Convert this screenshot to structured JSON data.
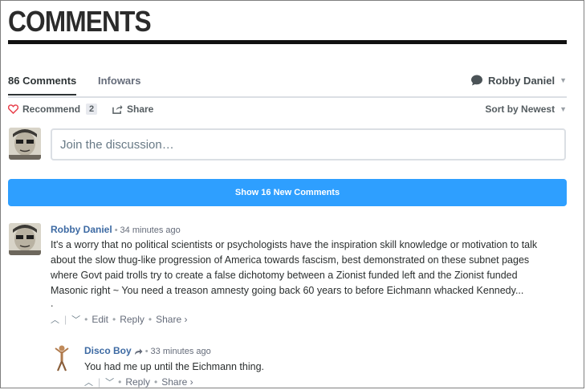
{
  "page_title": "COMMENTS",
  "nav": {
    "comment_count_tab": "86 Comments",
    "community_tab": "Infowars",
    "user_name": "Robby Daniel"
  },
  "actions": {
    "recommend_label": "Recommend",
    "recommend_count": "2",
    "share_label": "Share",
    "sort_label": "Sort by Newest"
  },
  "composer": {
    "placeholder": "Join the discussion…"
  },
  "new_comments_button": "Show 16 New Comments",
  "comments": [
    {
      "author": "Robby Daniel",
      "time": "34 minutes ago",
      "body_lines": [
        "It's a worry that no political scientists or psychologists have the inspiration skill knowledge or motivation to talk",
        "about the slow thug-like progression of America towards fascism, best demonstrated on these subnet pages",
        "where Govt paid trolls try to create a false dichotomy between a Zionist funded left and the Zionist funded",
        "Masonic right ~ You need a treason amnesty going back 60 years to before Eichmann whacked Kennedy...",
        "."
      ],
      "edit_label": "Edit",
      "reply_label": "Reply",
      "share_label": "Share ›"
    },
    {
      "author": "Disco Boy",
      "time": "33 minutes ago",
      "body": "You had me up until the Eichmann thing.",
      "reply_label": "Reply",
      "share_label": "Share ›"
    }
  ],
  "colors": {
    "accent_button": "#2e9fff",
    "author_link": "#3d6aa3",
    "title_rule": "#111111"
  }
}
